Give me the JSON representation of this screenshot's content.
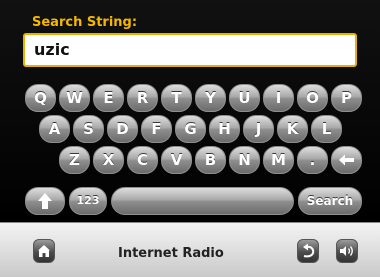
{
  "search": {
    "label": "Search String:",
    "value": "uzic"
  },
  "keyboard": {
    "row1": [
      "Q",
      "W",
      "E",
      "R",
      "T",
      "Y",
      "U",
      "I",
      "O",
      "P"
    ],
    "row2": [
      "A",
      "S",
      "D",
      "F",
      "G",
      "H",
      "J",
      "K",
      "L"
    ],
    "row3": [
      "Z",
      "X",
      "C",
      "V",
      "B",
      "N",
      "M",
      "."
    ],
    "backspace_icon": "backspace-arrow-icon",
    "shift_icon": "shift-up-arrow-icon",
    "numbers_label": "123",
    "search_label": "Search"
  },
  "bottom_bar": {
    "title": "Internet Radio",
    "home_icon": "home-icon",
    "back_icon": "back-icon",
    "volume_icon": "volume-icon"
  },
  "colors": {
    "accent": "#f5b800",
    "background": "#000000"
  }
}
